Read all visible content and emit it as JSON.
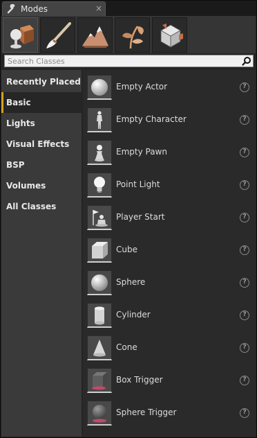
{
  "window": {
    "tab_title": "Modes",
    "tab_icon": "wrench-icon",
    "close_glyph": "×"
  },
  "mode_buttons": [
    {
      "name": "place-mode-icon",
      "active": true
    },
    {
      "name": "paint-mode-icon",
      "active": false
    },
    {
      "name": "landscape-mode-icon",
      "active": false
    },
    {
      "name": "foliage-mode-icon",
      "active": false
    },
    {
      "name": "geometry-mode-icon",
      "active": false
    }
  ],
  "search": {
    "placeholder": "Search Classes",
    "value": ""
  },
  "categories": [
    {
      "label": "Recently Placed",
      "active": false
    },
    {
      "label": "Basic",
      "active": true
    },
    {
      "label": "Lights",
      "active": false
    },
    {
      "label": "Visual Effects",
      "active": false
    },
    {
      "label": "BSP",
      "active": false
    },
    {
      "label": "Volumes",
      "active": false
    },
    {
      "label": "All Classes",
      "active": false
    }
  ],
  "items": [
    {
      "label": "Empty Actor",
      "icon": "empty-actor-icon"
    },
    {
      "label": "Empty Character",
      "icon": "empty-character-icon"
    },
    {
      "label": "Empty Pawn",
      "icon": "empty-pawn-icon"
    },
    {
      "label": "Point Light",
      "icon": "point-light-icon"
    },
    {
      "label": "Player Start",
      "icon": "player-start-icon"
    },
    {
      "label": "Cube",
      "icon": "cube-icon"
    },
    {
      "label": "Sphere",
      "icon": "sphere-icon"
    },
    {
      "label": "Cylinder",
      "icon": "cylinder-icon"
    },
    {
      "label": "Cone",
      "icon": "cone-icon"
    },
    {
      "label": "Box Trigger",
      "icon": "box-trigger-icon"
    },
    {
      "label": "Sphere Trigger",
      "icon": "sphere-trigger-icon"
    }
  ],
  "help_glyph": "?",
  "colors": {
    "accent": "#d6a11f",
    "panel": "#2a2a2a",
    "category_bg": "#3a3a3a"
  }
}
